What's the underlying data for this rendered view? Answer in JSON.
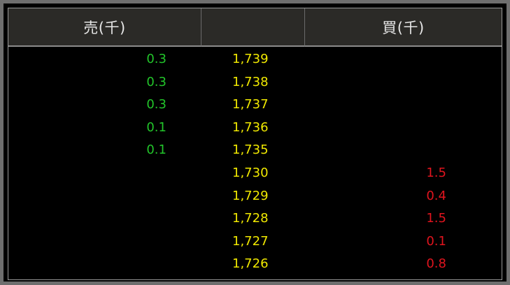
{
  "header": {
    "sell_label": "売(千)",
    "price_label": "",
    "buy_label": "買(千)"
  },
  "colors": {
    "sell": "#22c42a",
    "price": "#f0e800",
    "buy": "#e0141e",
    "header_bg": "#2b2a27",
    "background": "#000000"
  },
  "rows": [
    {
      "sell": "0.3",
      "price": "1,739",
      "buy": ""
    },
    {
      "sell": "0.3",
      "price": "1,738",
      "buy": ""
    },
    {
      "sell": "0.3",
      "price": "1,737",
      "buy": ""
    },
    {
      "sell": "0.1",
      "price": "1,736",
      "buy": ""
    },
    {
      "sell": "0.1",
      "price": "1,735",
      "buy": ""
    },
    {
      "sell": "",
      "price": "1,730",
      "buy": "1.5"
    },
    {
      "sell": "",
      "price": "1,729",
      "buy": "0.4"
    },
    {
      "sell": "",
      "price": "1,728",
      "buy": "1.5"
    },
    {
      "sell": "",
      "price": "1,727",
      "buy": "0.1"
    },
    {
      "sell": "",
      "price": "1,726",
      "buy": "0.8"
    }
  ]
}
